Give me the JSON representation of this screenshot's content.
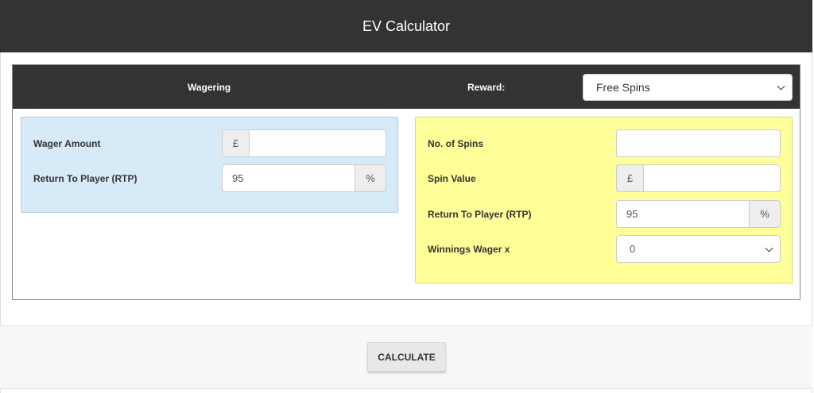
{
  "header": {
    "title": "EV Calculator"
  },
  "panel_head": {
    "wagering_label": "Wagering",
    "reward_label": "Reward:",
    "reward_select": {
      "value": "Free Spins"
    }
  },
  "wagering": {
    "wager_amount": {
      "label": "Wager Amount",
      "currency": "£",
      "value": ""
    },
    "rtp": {
      "label": "Return To Player (RTP)",
      "value": "95",
      "unit": "%"
    }
  },
  "reward": {
    "num_spins": {
      "label": "No. of Spins",
      "value": ""
    },
    "spin_value": {
      "label": "Spin Value",
      "currency": "£",
      "value": ""
    },
    "rtp": {
      "label": "Return To Player (RTP)",
      "value": "95",
      "unit": "%"
    },
    "winnings_wager": {
      "label": "Winnings Wager x",
      "value": "0"
    }
  },
  "footer": {
    "calculate_label": "CALCULATE"
  },
  "colors": {
    "header_bg": "#333333",
    "wagering_box_bg": "#d6eaf8",
    "reward_box_bg": "#ffff99",
    "footer_bg": "#f7f7f7"
  }
}
